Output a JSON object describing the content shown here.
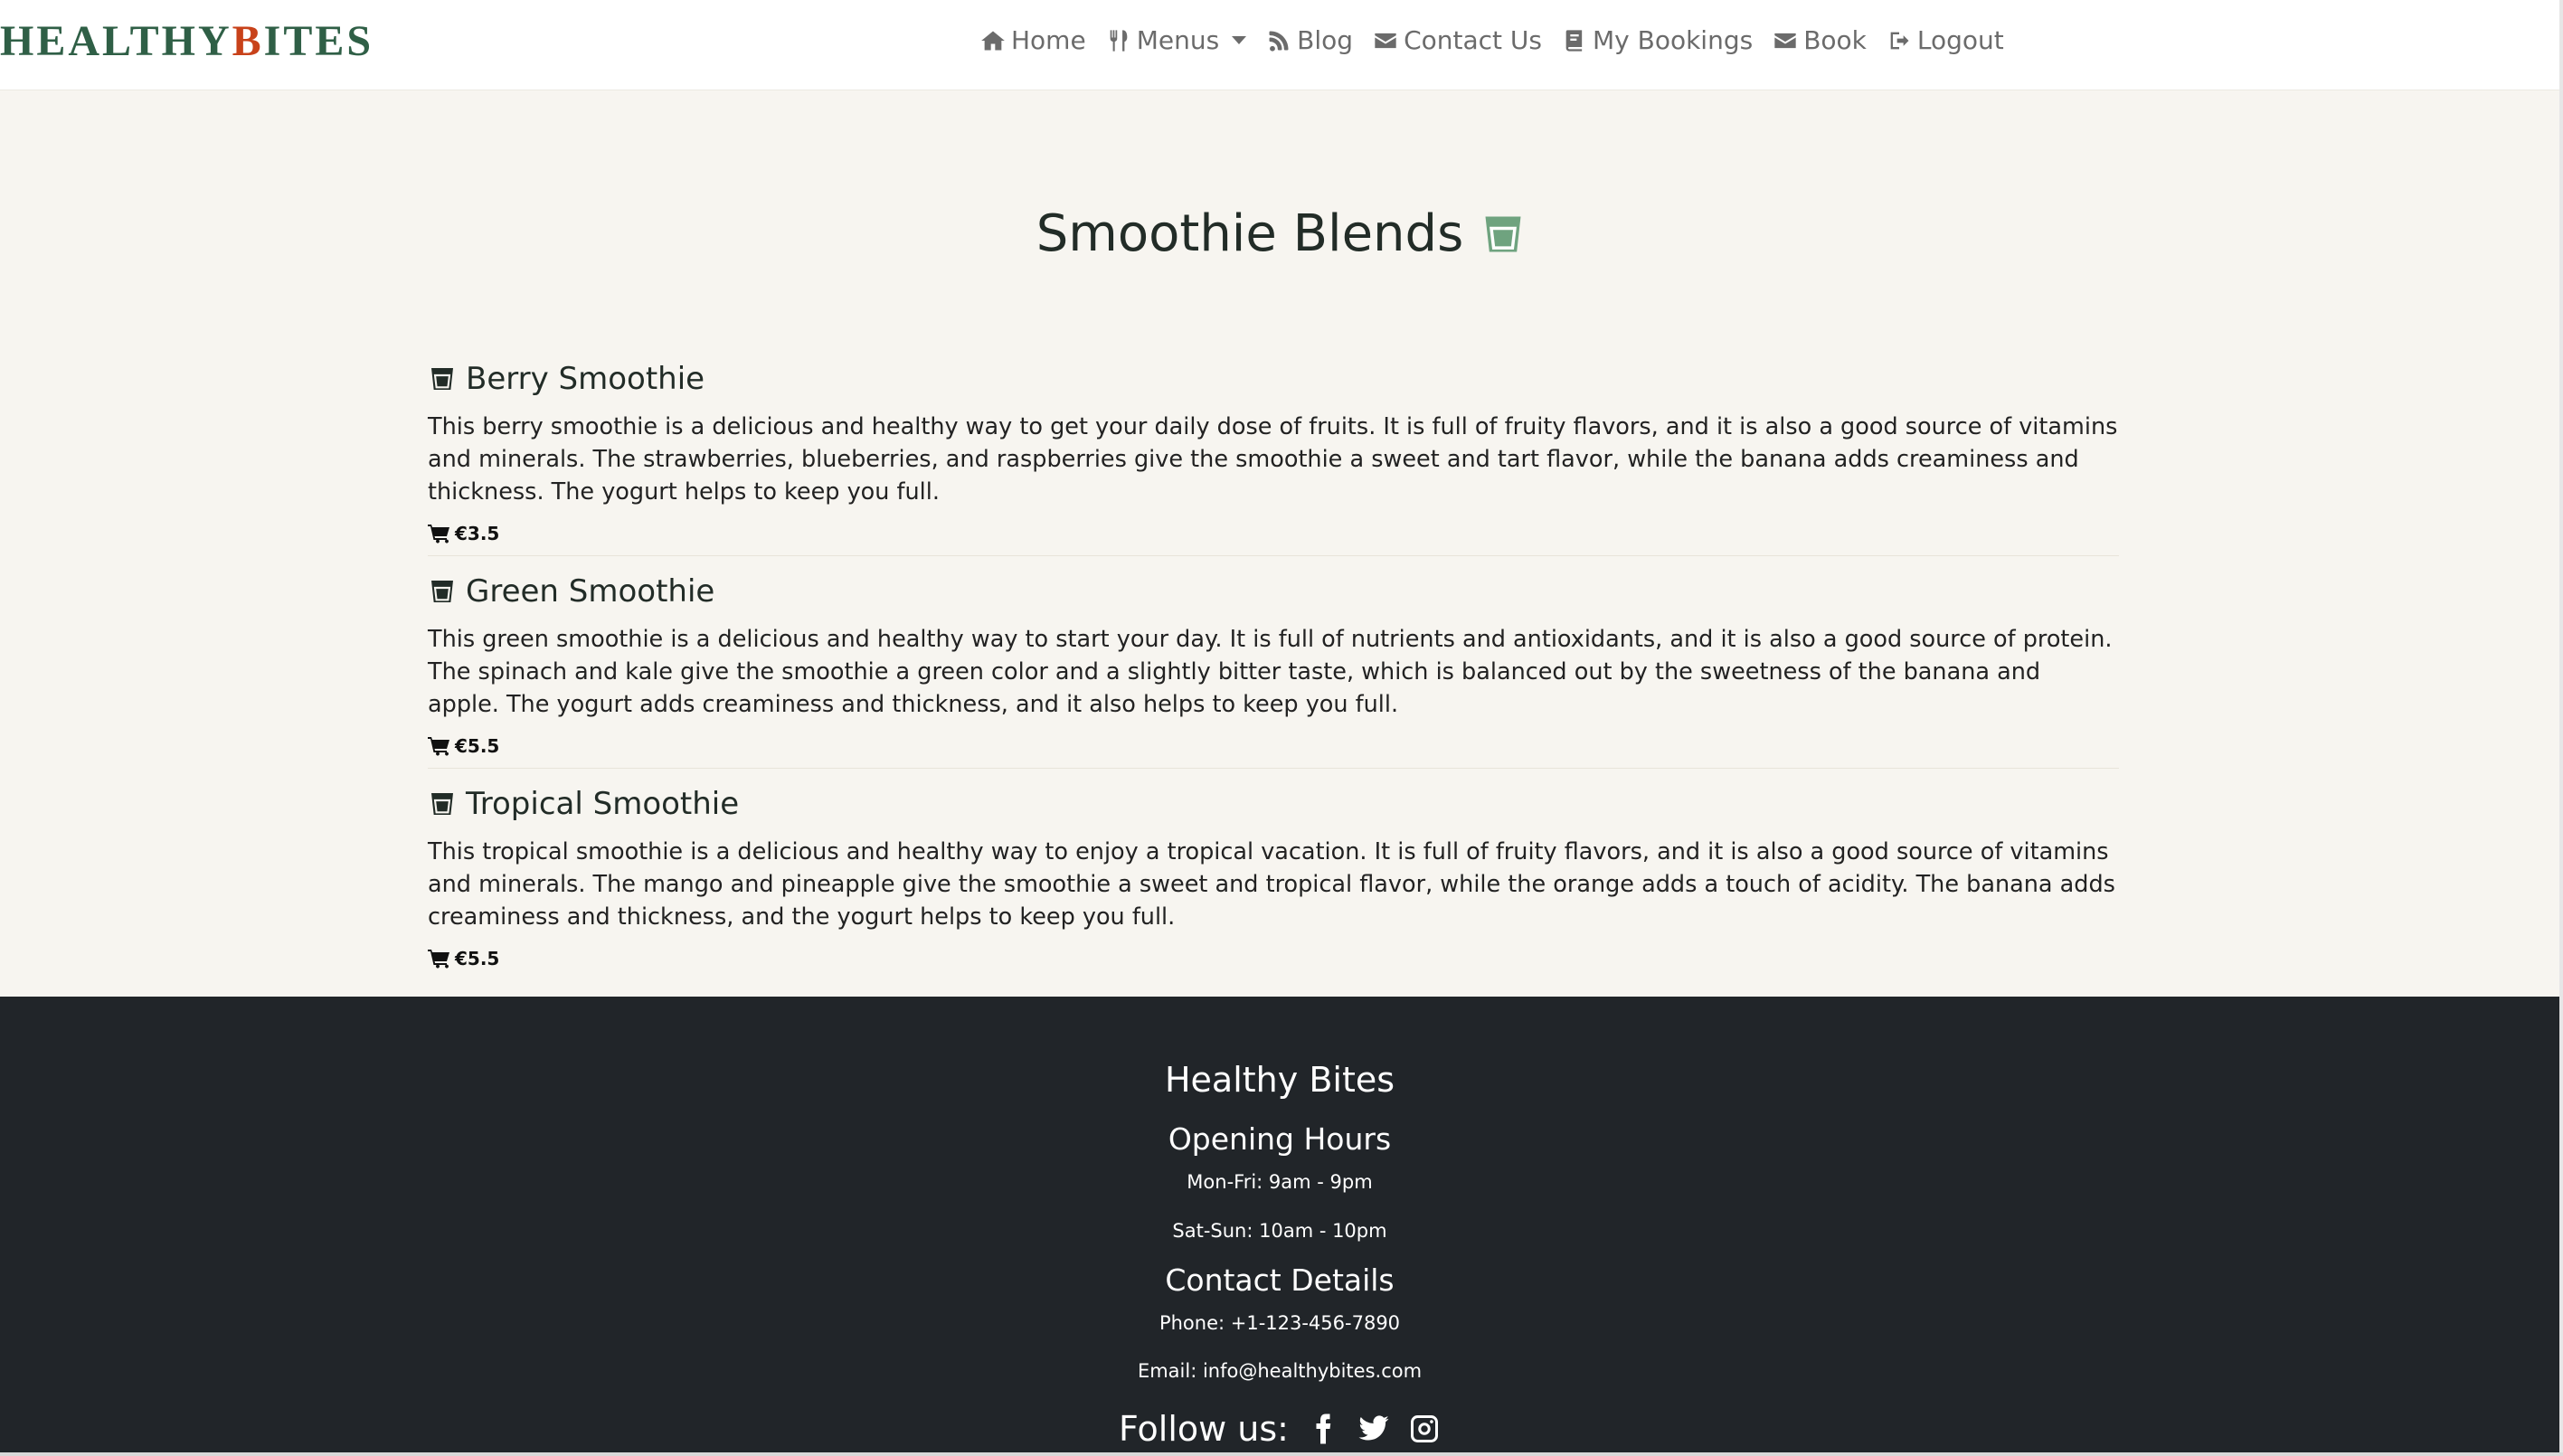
{
  "brand": {
    "part1": "HEALTHY",
    "part2": "B",
    "part3": "ITES"
  },
  "nav": {
    "items": [
      {
        "label": "Home",
        "icon": "home-icon"
      },
      {
        "label": "Menus",
        "icon": "utensils-icon"
      },
      {
        "label": "Blog",
        "icon": "blog-icon"
      },
      {
        "label": "Contact Us",
        "icon": "envelope-icon"
      },
      {
        "label": "My Bookings",
        "icon": "book-icon"
      },
      {
        "label": "Book",
        "icon": "envelope-icon"
      },
      {
        "label": "Logout",
        "icon": "logout-icon"
      }
    ]
  },
  "page": {
    "title": "Smoothie Blends",
    "title_icon": "glass-icon"
  },
  "items": [
    {
      "name": "Berry Smoothie",
      "description": "This berry smoothie is a delicious and healthy way to get your daily dose of fruits. It is full of fruity flavors, and it is also a good source of vitamins and minerals. The strawberries, blueberries, and raspberries give the smoothie a sweet and tart flavor, while the banana adds creaminess and thickness. The yogurt helps to keep you full.",
      "price": "€3.5"
    },
    {
      "name": "Green Smoothie",
      "description": "This green smoothie is a delicious and healthy way to start your day. It is full of nutrients and antioxidants, and it is also a good source of protein. The spinach and kale give the smoothie a green color and a slightly bitter taste, which is balanced out by the sweetness of the banana and apple. The yogurt adds creaminess and thickness, and it also helps to keep you full.",
      "price": "€5.5"
    },
    {
      "name": "Tropical Smoothie",
      "description": "This tropical smoothie is a delicious and healthy way to enjoy a tropical vacation. It is full of fruity flavors, and it is also a good source of vitamins and minerals. The mango and pineapple give the smoothie a sweet and tropical flavor, while the orange adds a touch of acidity. The banana adds creaminess and thickness, and the yogurt helps to keep you full.",
      "price": "€5.5"
    }
  ],
  "footer": {
    "brand": "Healthy Bites",
    "hours_heading": "Opening Hours",
    "hours_weekday": "Mon-Fri: 9am - 9pm",
    "hours_weekend": "Sat-Sun: 10am - 10pm",
    "contact_heading": "Contact Details",
    "phone": "Phone: +1-123-456-7890",
    "email": "Email: info@healthybites.com",
    "follow_label": "Follow us:",
    "social": [
      "facebook-icon",
      "twitter-icon",
      "instagram-icon"
    ]
  },
  "colors": {
    "brand_green": "#2f5f46",
    "brand_accent": "#c8421a",
    "glass_green": "#6fa37f",
    "footer_bg": "#212529",
    "page_bg": "#f7f5f0"
  }
}
